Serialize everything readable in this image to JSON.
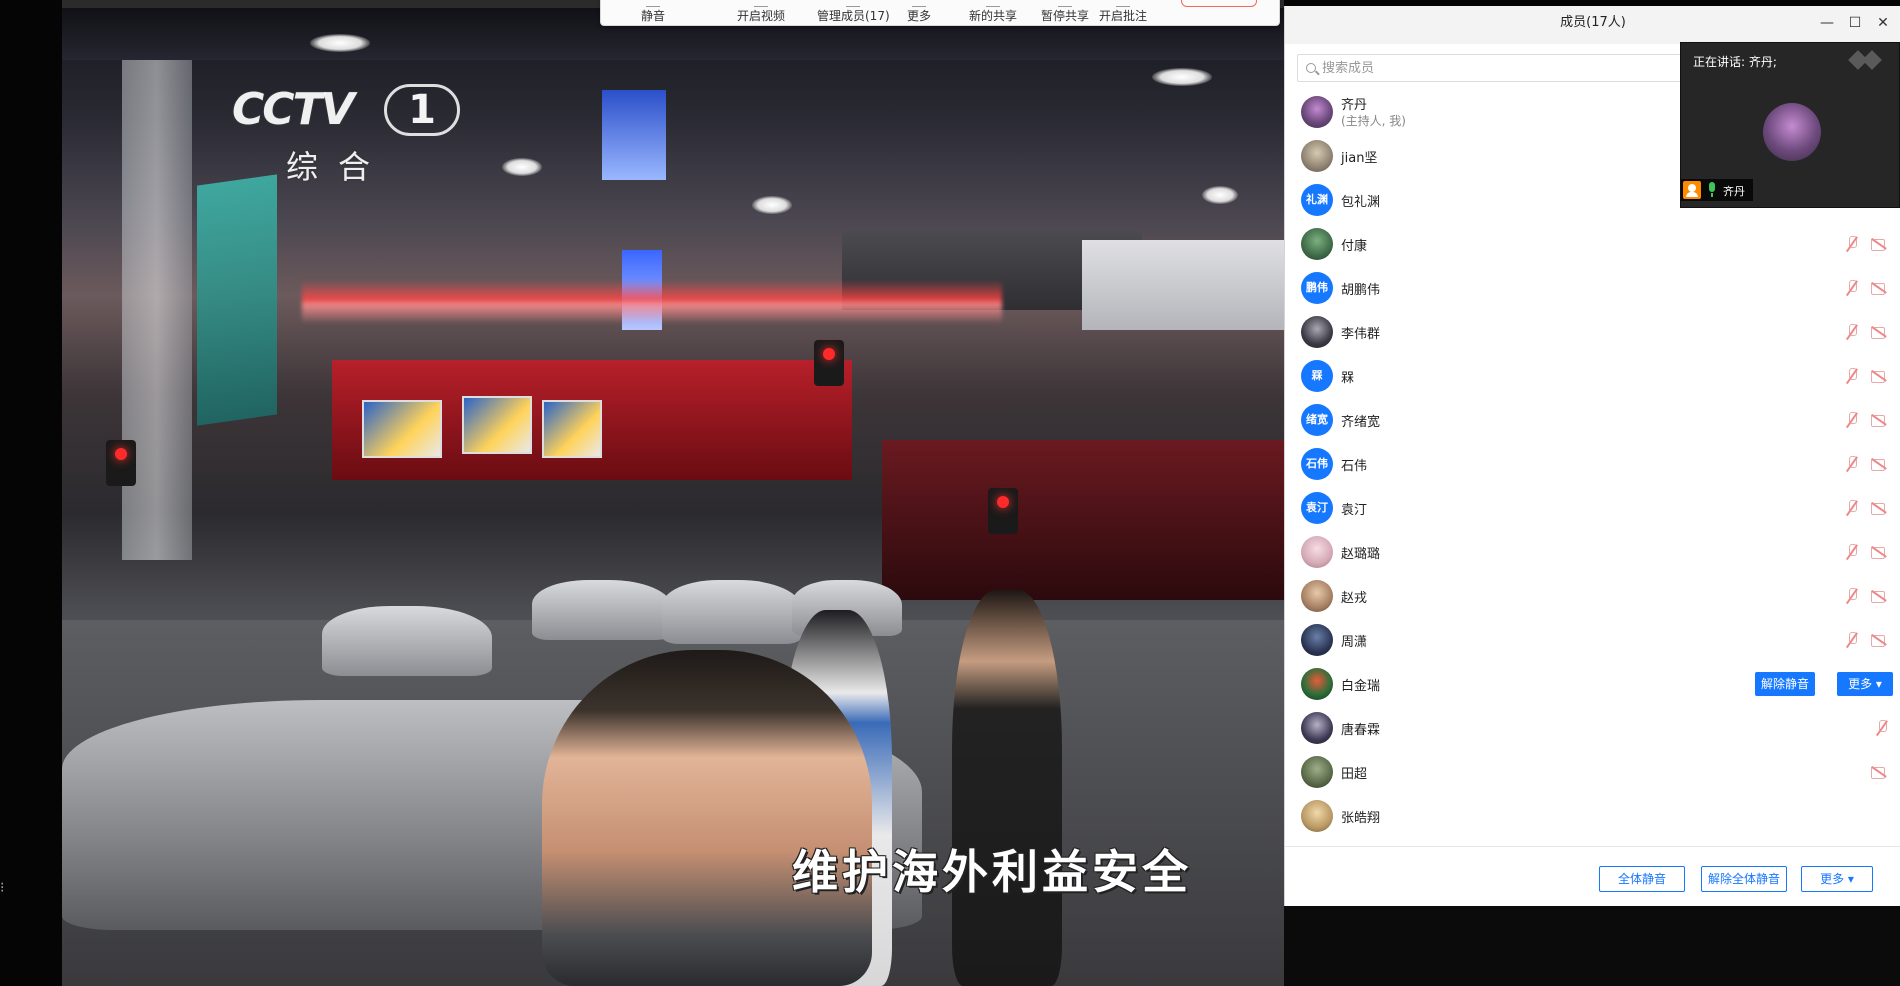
{
  "video": {
    "channel_logo_main": "CCTV",
    "channel_logo_number": "1",
    "channel_logo_sub": "综合",
    "subtitle": "维护海外利益安全"
  },
  "toolbar": {
    "buttons": [
      {
        "label": "静音",
        "icon": "mic-icon"
      },
      {
        "label": "开启视频",
        "icon": "video-icon"
      },
      {
        "label": "管理成员(17)",
        "icon": "members-icon"
      },
      {
        "label": "更多",
        "icon": "more-icon"
      },
      {
        "label": "新的共享",
        "icon": "share-icon"
      },
      {
        "label": "暂停共享",
        "icon": "pause-icon"
      },
      {
        "label": "开启批注",
        "icon": "annotate-icon"
      }
    ],
    "end_button_color": "#f16a5b"
  },
  "members_panel": {
    "title": "成员(17人)",
    "search_placeholder": "搜索成员",
    "members": [
      {
        "name": "齐丹",
        "subtitle": "(主持人, 我)",
        "avatar": "photo1"
      },
      {
        "name": "jian坚",
        "avatar": "photo2"
      },
      {
        "name": "包礼渊",
        "avatar_text": "礼渊"
      },
      {
        "name": "付康",
        "avatar": "photo3",
        "mic": "muted",
        "camera": "off"
      },
      {
        "name": "胡鹏伟",
        "avatar_text": "鹏伟",
        "mic": "muted",
        "camera": "off"
      },
      {
        "name": "李伟群",
        "avatar": "photo4",
        "mic": "muted",
        "camera": "off"
      },
      {
        "name": "槑",
        "avatar_text": "槑",
        "mic": "muted",
        "camera": "off"
      },
      {
        "name": "齐绪宽",
        "avatar_text": "绪宽",
        "mic": "muted",
        "camera": "off"
      },
      {
        "name": "石伟",
        "avatar_text": "石伟",
        "mic": "muted",
        "camera": "off"
      },
      {
        "name": "袁汀",
        "avatar_text": "袁汀",
        "mic": "muted",
        "camera": "off"
      },
      {
        "name": "赵璐璐",
        "avatar": "photo5",
        "mic": "muted",
        "camera": "off"
      },
      {
        "name": "赵戎",
        "avatar": "photo6",
        "mic": "muted",
        "camera": "off"
      },
      {
        "name": "周潇",
        "avatar": "photo7",
        "mic": "muted",
        "camera": "off"
      },
      {
        "name": "白金瑞",
        "avatar": "photo8",
        "actions": [
          "解除静音",
          "更多"
        ]
      },
      {
        "name": "唐春霖",
        "avatar": "photo9",
        "mic": "muted"
      },
      {
        "name": "田超",
        "avatar": "photo10",
        "camera": "off"
      },
      {
        "name": "张皓翔",
        "avatar": "photo11"
      }
    ],
    "footer": {
      "mute_all": "全体静音",
      "unmute_all": "解除全体静音",
      "more": "更多"
    },
    "accent_color": "#1677ff"
  },
  "speaker_window": {
    "label": "正在讲话: 齐丹;",
    "name": "齐丹"
  }
}
